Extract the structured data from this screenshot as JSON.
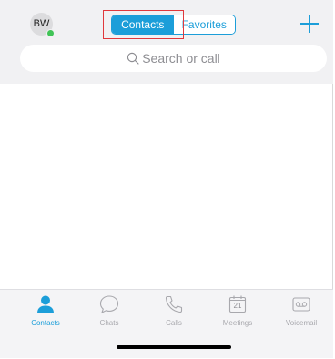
{
  "header": {
    "avatar_initials": "BW",
    "segments": [
      {
        "label": "Contacts"
      },
      {
        "label": "Favorites"
      }
    ]
  },
  "search": {
    "placeholder": "Search or call"
  },
  "tabbar": {
    "tabs": [
      {
        "label": "Contacts",
        "icon": "person-icon"
      },
      {
        "label": "Chats",
        "icon": "chat-bubble-icon"
      },
      {
        "label": "Calls",
        "icon": "phone-icon"
      },
      {
        "label": "Meetings",
        "icon": "calendar-icon",
        "day": "21"
      },
      {
        "label": "Voicemail",
        "icon": "voicemail-icon"
      }
    ]
  },
  "colors": {
    "accent": "#1c9ed9",
    "presence": "#41c457",
    "focus_outline": "#e0383c"
  }
}
